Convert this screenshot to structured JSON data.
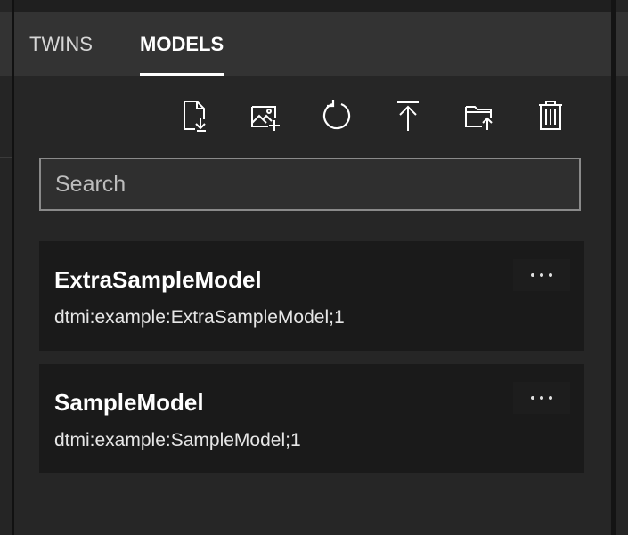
{
  "tabs": [
    {
      "label": "TWINS",
      "active": false
    },
    {
      "label": "MODELS",
      "active": true
    }
  ],
  "toolbar": {
    "icons": [
      "import-model-icon",
      "import-image-icon",
      "refresh-icon",
      "upload-icon",
      "upload-folder-icon",
      "delete-icon"
    ]
  },
  "search": {
    "placeholder": "Search",
    "value": ""
  },
  "models": [
    {
      "name": "ExtraSampleModel",
      "id": "dtmi:example:ExtraSampleModel;1"
    },
    {
      "name": "SampleModel",
      "id": "dtmi:example:SampleModel;1"
    }
  ],
  "colors": {
    "panel": "#262626",
    "tabbar": "#333333",
    "card": "#1a1a1a",
    "accent": "#ffffff"
  }
}
